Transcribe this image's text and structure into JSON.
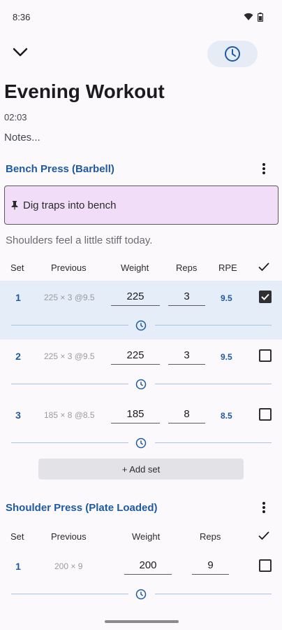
{
  "status": {
    "time": "8:36"
  },
  "workout": {
    "title": "Evening Workout",
    "duration": "02:03",
    "notes_placeholder": "Notes..."
  },
  "exercises": [
    {
      "name": "Bench Press (Barbell)",
      "pinned_note": "Dig traps into bench",
      "note": "Shoulders feel a little stiff today.",
      "headers": {
        "set": "Set",
        "previous": "Previous",
        "weight": "Weight",
        "reps": "Reps",
        "rpe": "RPE"
      },
      "sets": [
        {
          "num": "1",
          "previous": "225 × 3 @9.5",
          "weight": "225",
          "reps": "3",
          "rpe": "9.5",
          "done": true
        },
        {
          "num": "2",
          "previous": "225 × 3 @9.5",
          "weight": "225",
          "reps": "3",
          "rpe": "9.5",
          "done": false
        },
        {
          "num": "3",
          "previous": "185 × 8 @8.5",
          "weight": "185",
          "reps": "8",
          "rpe": "8.5",
          "done": false
        }
      ],
      "add_set_label": "+ Add set"
    },
    {
      "name": "Shoulder Press (Plate Loaded)",
      "headers": {
        "set": "Set",
        "previous": "Previous",
        "weight": "Weight",
        "reps": "Reps"
      },
      "sets": [
        {
          "num": "1",
          "previous": "200 × 9",
          "weight": "200",
          "reps": "9",
          "done": false
        }
      ]
    }
  ],
  "colors": {
    "accent": "#1e5aa0",
    "completed_row": "#e5edf8",
    "pinned_note_bg": "#f1ddf8"
  }
}
